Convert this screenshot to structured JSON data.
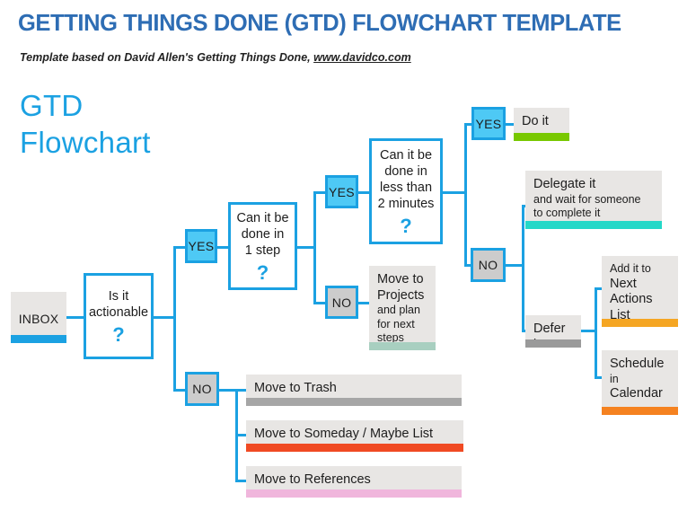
{
  "header": {
    "title": "GETTING THINGS DONE (GTD) FLOWCHART TEMPLATE",
    "subtitle_text": "Template based on David Allen's Getting Things Done,",
    "subtitle_link": "www.davidco.com",
    "title_color": "#2e6db4"
  },
  "side_title": {
    "line1": "GTD",
    "line2": "Flowchart",
    "color": "#1ba1e2"
  },
  "flow": {
    "inbox": {
      "label": "INBOX",
      "accent": "#1ba1e2"
    },
    "decision_actionable": {
      "text": "Is it\nactionable",
      "mark": "?"
    },
    "chip_actionable_yes": {
      "label": "YES"
    },
    "chip_actionable_no": {
      "label": "NO"
    },
    "decision_one_step": {
      "text": "Can it be\ndone in\n1 step",
      "mark": "?"
    },
    "chip_one_step_yes": {
      "label": "YES"
    },
    "chip_one_step_no": {
      "label": "NO"
    },
    "decision_two_minutes": {
      "text": "Can it be\ndone in\nless than\n2 minutes",
      "mark": "?"
    },
    "chip_two_min_yes": {
      "label": "YES"
    },
    "chip_two_min_no": {
      "label": "NO"
    },
    "card_do_it": {
      "line1": "Do it",
      "accent": "#78c800"
    },
    "card_delegate": {
      "line1": "Delegate it",
      "line2": "and wait for someone\nto complete it",
      "accent": "#24d8c8"
    },
    "card_projects": {
      "line1": "Move to\nProjects",
      "line2": "and plan\nfor next\nsteps",
      "accent": "#a8cfc0"
    },
    "card_defer": {
      "line1": "Defer it",
      "accent": "#9a9a9a"
    },
    "card_next_actions": {
      "line1": "Add it to",
      "line2": "Next\nActions\nList",
      "accent": "#f5a623"
    },
    "card_calendar": {
      "line1": "Schedule",
      "line2": "in",
      "line3": "Calendar",
      "accent": "#f58220"
    },
    "card_trash": {
      "line1": "Move to Trash",
      "accent": "#a6a6a6"
    },
    "card_someday": {
      "line1": "Move to Someday / Maybe List",
      "accent": "#f04a23"
    },
    "card_references": {
      "line1": "Move to References",
      "accent": "#f0b6dc"
    }
  }
}
